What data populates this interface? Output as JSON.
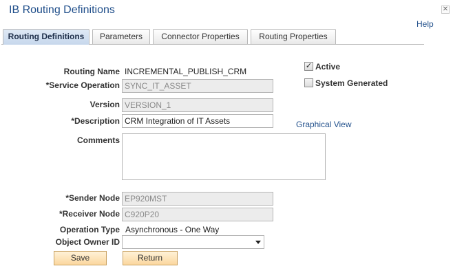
{
  "window": {
    "title": "IB Routing Definitions",
    "close_icon": "close-icon",
    "help_link": "Help"
  },
  "tabs": [
    {
      "label": "Routing Definitions",
      "active": true
    },
    {
      "label": "Parameters",
      "active": false
    },
    {
      "label": "Connector Properties",
      "active": false
    },
    {
      "label": "Routing Properties",
      "active": false
    }
  ],
  "form": {
    "routing_name": {
      "label": "Routing Name",
      "value": "INCREMENTAL_PUBLISH_CRM"
    },
    "service_operation": {
      "label": "*Service Operation",
      "value": "SYNC_IT_ASSET"
    },
    "version": {
      "label": "Version",
      "value": "VERSION_1"
    },
    "description": {
      "label": "*Description",
      "value": "CRM Integration of IT Assets"
    },
    "comments": {
      "label": "Comments",
      "value": ""
    },
    "sender_node": {
      "label": "*Sender Node",
      "value": "EP920MST"
    },
    "receiver_node": {
      "label": "*Receiver Node",
      "value": "C920P20"
    },
    "operation_type": {
      "label": "Operation Type",
      "value": "Asynchronous - One Way"
    },
    "object_owner_id": {
      "label": "Object Owner ID",
      "value": ""
    }
  },
  "checkboxes": {
    "active": {
      "label": "Active",
      "checked": true
    },
    "system_generated": {
      "label": "System Generated",
      "checked": false
    }
  },
  "graphical_view_link": "Graphical View",
  "buttons": {
    "save": "Save",
    "return": "Return"
  }
}
